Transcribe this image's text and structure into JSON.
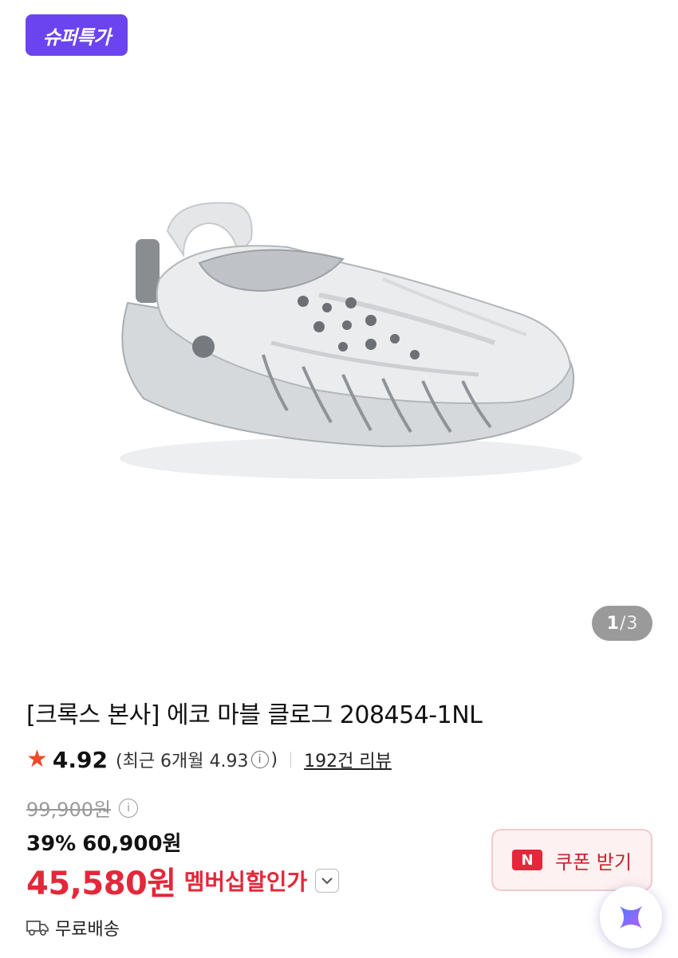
{
  "badge": {
    "label": "슈퍼특가",
    "color": "#6b44f0"
  },
  "gallery": {
    "current": "1",
    "separator": "/",
    "total": "3"
  },
  "product": {
    "title": "[크록스 본사] 에코 마블 클로그 208454-1NL"
  },
  "rating": {
    "score": "4.92",
    "recent_prefix": "(최근 6개월 4.93",
    "recent_suffix": ")",
    "reviews": "192건 리뷰",
    "star_color": "#ef4a2a"
  },
  "price": {
    "original": "99,900원",
    "discount_pct": "39%",
    "sale": "60,900원",
    "member_price": "45,580원",
    "member_label": "멤버십할인가",
    "member_color": "#e4273a"
  },
  "coupon": {
    "label": "쿠폰 받기",
    "icon_text": "N"
  },
  "shipping": {
    "label": "무료배송"
  },
  "icons": [
    "star-icon",
    "info-icon",
    "chevron-down-icon",
    "truck-icon",
    "naver-n-icon",
    "assistant-icon"
  ]
}
